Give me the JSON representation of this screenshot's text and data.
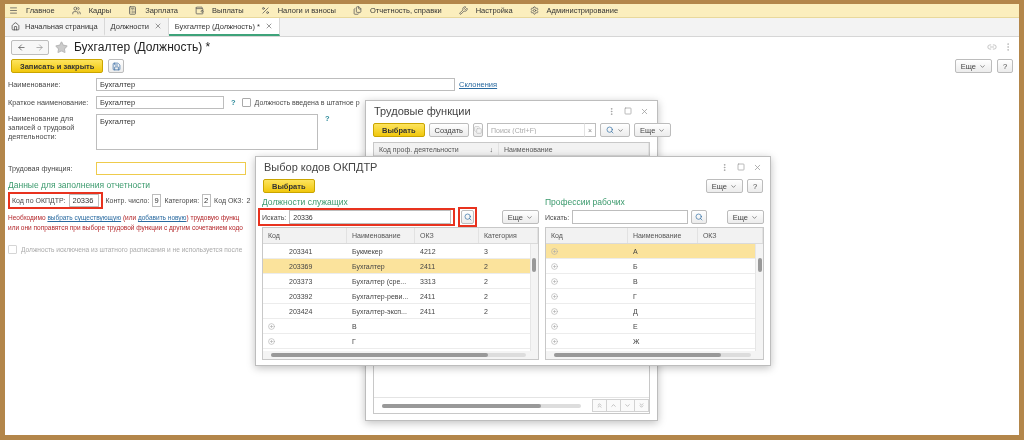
{
  "menu": [
    {
      "label": "Главное"
    },
    {
      "label": "Кадры"
    },
    {
      "label": "Зарплата"
    },
    {
      "label": "Выплаты"
    },
    {
      "label": "Налоги и взносы"
    },
    {
      "label": "Отчетность, справки"
    },
    {
      "label": "Настройка"
    },
    {
      "label": "Администрирование"
    }
  ],
  "tabs": [
    {
      "label": "Начальная страница",
      "selected": false,
      "closable": false
    },
    {
      "label": "Должности",
      "selected": false,
      "closable": true
    },
    {
      "label": "Бухгалтер (Должность) *",
      "selected": true,
      "closable": true
    }
  ],
  "header": {
    "title": "Бухгалтер (Должность) *",
    "favorite": false
  },
  "toolbar": {
    "primary": "Записать и закрыть",
    "more": "Еще",
    "help": "?"
  },
  "name": {
    "label": "Наименование:",
    "value": "Бухгалтер",
    "link": "Склонения"
  },
  "short_name": {
    "label": "Краткое наименование:",
    "value": "Бухгалтер",
    "help": "?",
    "checkbox": {
      "label": "Должность введена в штатное р",
      "checked": false
    }
  },
  "record_name": {
    "label": "Наименование для записей о трудовой деятельности:",
    "value": "Бухгалтер",
    "help": "?"
  },
  "labor_function": {
    "label": "Трудовая функция:"
  },
  "reporting": {
    "heading": "Данные для заполнения отчетности",
    "highlighted": true,
    "okpdtr_label": "Код по ОКПДТР:",
    "okpdtr": "20336",
    "control_label": "Контр. число:",
    "control": "9",
    "category_label": "Категория:",
    "category": "2",
    "okz_label": "Код ОКЗ:",
    "okz": "2"
  },
  "warning": {
    "lines": [
      [
        {
          "text": "Необходимо "
        },
        {
          "text": "выбрать существующую",
          "link": true
        },
        {
          "text": " (или "
        },
        {
          "text": "добавить новую",
          "link": true
        },
        {
          "text": ") трудовую функц"
        }
      ],
      [
        {
          "text": "или они поправятся при выборе трудовой функции с другим сочетанием кодо"
        }
      ]
    ]
  },
  "excluded": {
    "label": "Должность исключена из штатного расписания и не используется после",
    "checked": false,
    "disabled": true
  },
  "functions_dialog": {
    "title": "Трудовые функции",
    "select": "Выбрать",
    "create": "Создать",
    "search_placeholder": "Поиск (Ctrl+F)",
    "clear": "×",
    "more": "Еще",
    "columns": [
      "Код проф. деятельности",
      "Наименование"
    ],
    "sort": "↓"
  },
  "okpdtr_dialog": {
    "title": "Выбор кодов ОКПДТР",
    "select": "Выбрать",
    "more": "Еще",
    "help": "?",
    "left": {
      "heading": "Должности служащих",
      "search_label": "Искать:",
      "search_value": "20336",
      "search_highlighted": true,
      "button_highlighted": true,
      "more": "Еще",
      "columns": [
        "Код",
        "Наименование",
        "ОКЗ",
        "Категория"
      ],
      "rows": [
        {
          "kind": "item",
          "code": "203341",
          "name": "Букмекер",
          "okz": "4212",
          "category": "3",
          "selected": false
        },
        {
          "kind": "item",
          "code": "203369",
          "name": "Бухгалтер",
          "okz": "2411",
          "category": "2",
          "selected": true
        },
        {
          "kind": "item",
          "code": "203373",
          "name": "Бухгалтер (сре...",
          "okz": "3313",
          "category": "2",
          "selected": false
        },
        {
          "kind": "item",
          "code": "203392",
          "name": "Бухгалтер-реви...",
          "okz": "2411",
          "category": "2",
          "selected": false
        },
        {
          "kind": "item",
          "code": "203424",
          "name": "Бухгалтер-эксп...",
          "okz": "2411",
          "category": "2",
          "selected": false
        },
        {
          "kind": "group",
          "name": "В",
          "selected": false
        },
        {
          "kind": "group",
          "name": "Г",
          "selected": false
        }
      ]
    },
    "right": {
      "heading": "Профессии рабочих",
      "search_label": "Искать:",
      "more": "Еще",
      "columns": [
        "Код",
        "Наименование",
        "ОКЗ"
      ],
      "rows": [
        {
          "kind": "group",
          "name": "А",
          "selected": true
        },
        {
          "kind": "group",
          "name": "Б",
          "selected": false
        },
        {
          "kind": "group",
          "name": "В",
          "selected": false
        },
        {
          "kind": "group",
          "name": "Г",
          "selected": false
        },
        {
          "kind": "group",
          "name": "Д",
          "selected": false
        },
        {
          "kind": "group",
          "name": "Е",
          "selected": false
        },
        {
          "kind": "group",
          "name": "Ж",
          "selected": false
        }
      ]
    }
  }
}
